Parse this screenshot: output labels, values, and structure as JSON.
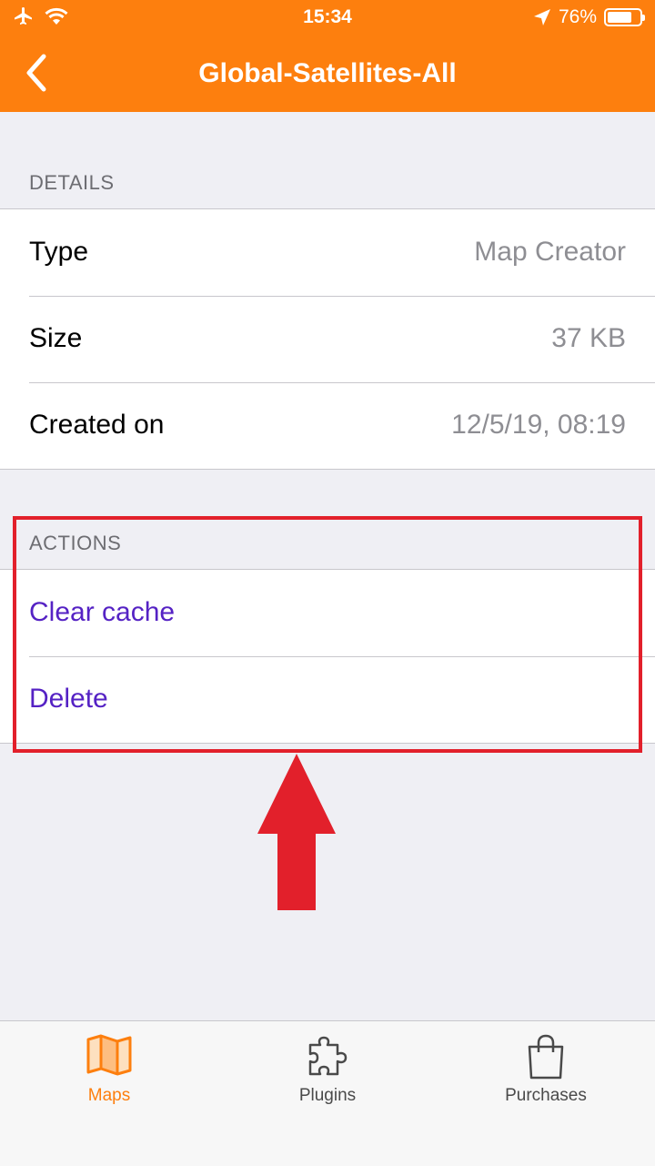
{
  "status_bar": {
    "time": "15:34",
    "battery_percent": "76%",
    "battery_level": 0.76,
    "icons": [
      "airplane-icon",
      "wifi-icon",
      "location-arrow-icon",
      "battery-icon"
    ]
  },
  "nav": {
    "title": "Global-Satellites-All",
    "back_icon": "chevron-left-icon"
  },
  "details": {
    "header": "DETAILS",
    "rows": [
      {
        "label": "Type",
        "value": "Map Creator"
      },
      {
        "label": "Size",
        "value": "37 KB"
      },
      {
        "label": "Created on",
        "value": "12/5/19, 08:19"
      }
    ]
  },
  "actions": {
    "header": "ACTIONS",
    "items": [
      {
        "label": "Clear cache"
      },
      {
        "label": "Delete"
      }
    ]
  },
  "annotation": {
    "highlight_color": "#e2202b",
    "arrow_color": "#e2202b"
  },
  "tab_bar": {
    "tabs": [
      {
        "label": "Maps",
        "icon": "map-icon",
        "selected": true
      },
      {
        "label": "Plugins",
        "icon": "puzzle-piece-icon",
        "selected": false
      },
      {
        "label": "Purchases",
        "icon": "shopping-bag-icon",
        "selected": false
      }
    ]
  },
  "colors": {
    "brand_orange": "#fd7f0e",
    "action_purple": "#5522c4",
    "tab_inactive": "#4a4a4a"
  }
}
